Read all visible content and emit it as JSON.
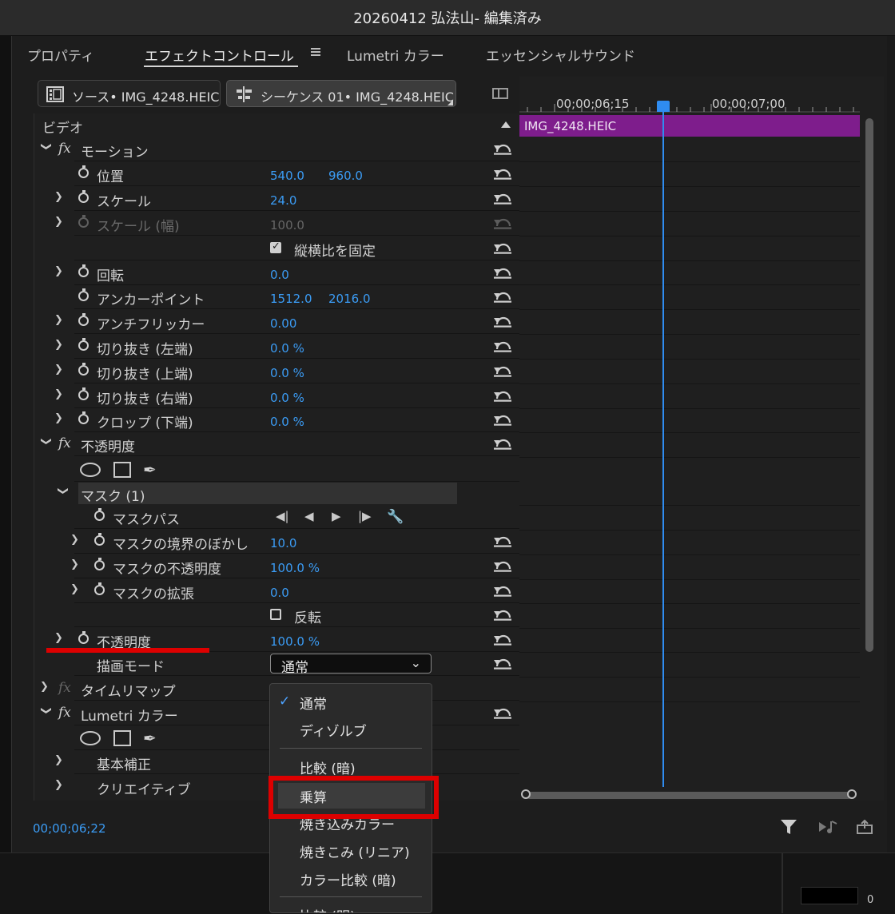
{
  "window": {
    "title": "20260412 弘法山- 編集済み"
  },
  "tabs": [
    {
      "label": "プロパティ"
    },
    {
      "label": "エフェクトコントロール"
    },
    {
      "label": "Lumetri カラー"
    },
    {
      "label": "エッセンシャルサウンド"
    }
  ],
  "source": {
    "source_label": "ソース• IMG_4248.HEIC",
    "sequence_label": "シーケンス 01• IMG_4248.HEIC"
  },
  "section": {
    "video_label": "ビデオ"
  },
  "rows": {
    "motion": "モーション",
    "position": {
      "label": "位置",
      "x": "540.0",
      "y": "960.0"
    },
    "scale": {
      "label": "スケール",
      "value": "24.0"
    },
    "scale_width": {
      "label": "スケール (幅)",
      "value": "100.0"
    },
    "uniform_scale": {
      "label": "縦横比を固定",
      "checked": true
    },
    "rotation": {
      "label": "回転",
      "value": "0.0"
    },
    "anchor": {
      "label": "アンカーポイント",
      "x": "1512.0",
      "y": "2016.0"
    },
    "antiflicker": {
      "label": "アンチフリッカー",
      "value": "0.00"
    },
    "crop_left": {
      "label": "切り抜き (左端)",
      "value": "0.0 %"
    },
    "crop_top": {
      "label": "切り抜き (上端)",
      "value": "0.0 %"
    },
    "crop_right": {
      "label": "切り抜き (右端)",
      "value": "0.0 %"
    },
    "crop_bottom": {
      "label": "クロップ (下端)",
      "value": "0.0 %"
    },
    "opacity_fx": "不透明度",
    "mask": "マスク (1)",
    "mask_path": "マスクパス",
    "mask_feather": {
      "label": "マスクの境界のぼかし",
      "value": "10.0"
    },
    "mask_opacity": {
      "label": "マスクの不透明度",
      "value": "100.0 %"
    },
    "mask_expansion": {
      "label": "マスクの拡張",
      "value": "0.0"
    },
    "inverted": {
      "label": "反転",
      "checked": false
    },
    "opacity": {
      "label": "不透明度",
      "value": "100.0 %"
    },
    "blend_mode": {
      "label": "描画モード",
      "value": "通常"
    },
    "time_remap": "タイムリマップ",
    "lumetri": "Lumetri カラー",
    "basic_correction": "基本補正",
    "creative": "クリエイティブ"
  },
  "timeline": {
    "ruler_left": "00;00;06;15",
    "ruler_right": "00;00;07;00",
    "clip_name": "IMG_4248.HEIC"
  },
  "footer": {
    "timecode": "00;00;06;22",
    "meter_value": "0"
  },
  "dropdown": {
    "items": [
      "通常",
      "ディゾルブ",
      "比較 (暗)",
      "乗算",
      "焼き込みカラー",
      "焼きこみ (リニア)",
      "カラー比較 (暗)",
      "比較 (明)"
    ],
    "selected": "通常",
    "highlighted": "乗算"
  },
  "colors": {
    "accent_blue": "#3b9cf5",
    "clip_purple": "#7e1d8c",
    "annotation_red": "#dd0000"
  }
}
